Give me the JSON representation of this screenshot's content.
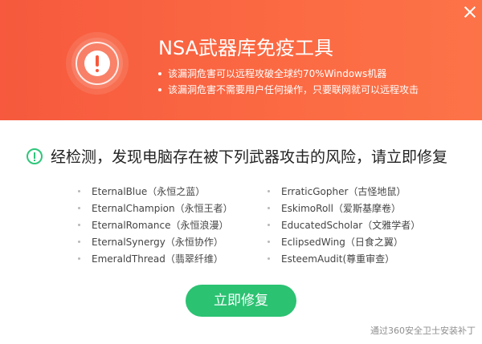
{
  "header": {
    "title": "NSA武器库免疫工具",
    "bullets": [
      "该漏洞危害可以远程攻破全球约70%Windows机器",
      "该漏洞危害不需要用户任何操作，只要联网就可以远程攻击"
    ]
  },
  "result": {
    "headline": "经检测，发现电脑存在被下列武器攻击的风险，请立即修复"
  },
  "weapons_left": [
    "EternalBlue（永恒之蓝）",
    "EternalChampion（永恒王者）",
    "EternalRomance（永恒浪漫）",
    "EternalSynergy（永恒协作）",
    "EmeraldThread（翡翠纤维）"
  ],
  "weapons_right": [
    "ErraticGopher（古怪地鼠）",
    "EskimoRoll（爱斯基摩卷）",
    "EducatedScholar（文雅学者）",
    "EclipsedWing（日食之翼）",
    "EsteemAudit(尊重审查）"
  ],
  "actions": {
    "fix_label": "立即修复"
  },
  "footer": {
    "text": "通过360安全卫士安装补丁"
  },
  "colors": {
    "header_bg": "#f6593d",
    "accent_green": "#2bc272"
  },
  "icons": {
    "close": "close-icon",
    "alert": "alert-icon",
    "check": "check-circle-icon"
  }
}
